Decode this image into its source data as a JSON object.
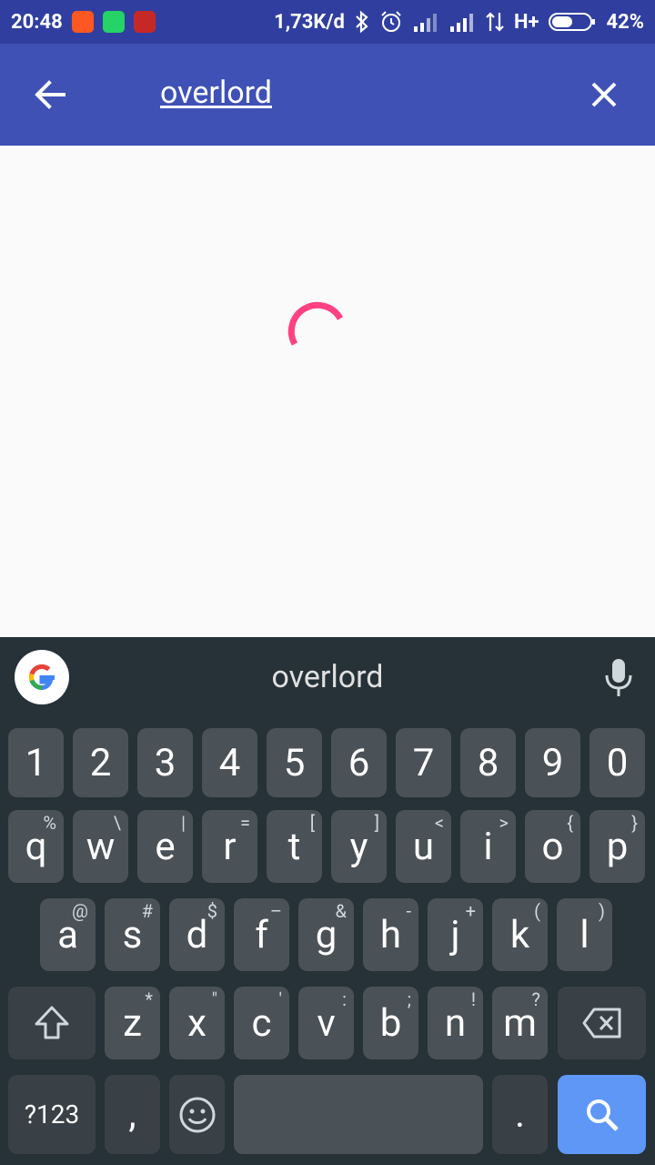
{
  "status_bar": {
    "time": "20:48",
    "speed": "1,73K/d",
    "network": "H+",
    "battery": "42%"
  },
  "app_bar": {
    "search_query": "overlord"
  },
  "keyboard": {
    "suggestion": "overlord",
    "number_row": [
      "1",
      "2",
      "3",
      "4",
      "5",
      "6",
      "7",
      "8",
      "9",
      "0"
    ],
    "row1": [
      {
        "k": "q",
        "h": "%"
      },
      {
        "k": "w",
        "h": "\\"
      },
      {
        "k": "e",
        "h": "|"
      },
      {
        "k": "r",
        "h": "="
      },
      {
        "k": "t",
        "h": "["
      },
      {
        "k": "y",
        "h": "]"
      },
      {
        "k": "u",
        "h": "<"
      },
      {
        "k": "i",
        "h": ">"
      },
      {
        "k": "o",
        "h": "{"
      },
      {
        "k": "p",
        "h": "}"
      }
    ],
    "row2": [
      {
        "k": "a",
        "h": "@"
      },
      {
        "k": "s",
        "h": "#"
      },
      {
        "k": "d",
        "h": "$"
      },
      {
        "k": "f",
        "h": "–"
      },
      {
        "k": "g",
        "h": "&"
      },
      {
        "k": "h",
        "h": "-"
      },
      {
        "k": "j",
        "h": "+"
      },
      {
        "k": "k",
        "h": "("
      },
      {
        "k": "l",
        "h": ")"
      }
    ],
    "row3": [
      {
        "k": "z",
        "h": "*"
      },
      {
        "k": "x",
        "h": "\""
      },
      {
        "k": "c",
        "h": "'"
      },
      {
        "k": "v",
        "h": ":"
      },
      {
        "k": "b",
        "h": ";"
      },
      {
        "k": "n",
        "h": "!"
      },
      {
        "k": "m",
        "h": "?"
      }
    ],
    "symbols_label": "?123",
    "comma": ",",
    "period": "."
  },
  "colors": {
    "status_bar": "#303f9f",
    "app_bar": "#3f51b5",
    "spinner": "#ff4081",
    "keyboard_bg": "#263238",
    "key": "#4b5257",
    "action_key": "#5e97f6"
  }
}
